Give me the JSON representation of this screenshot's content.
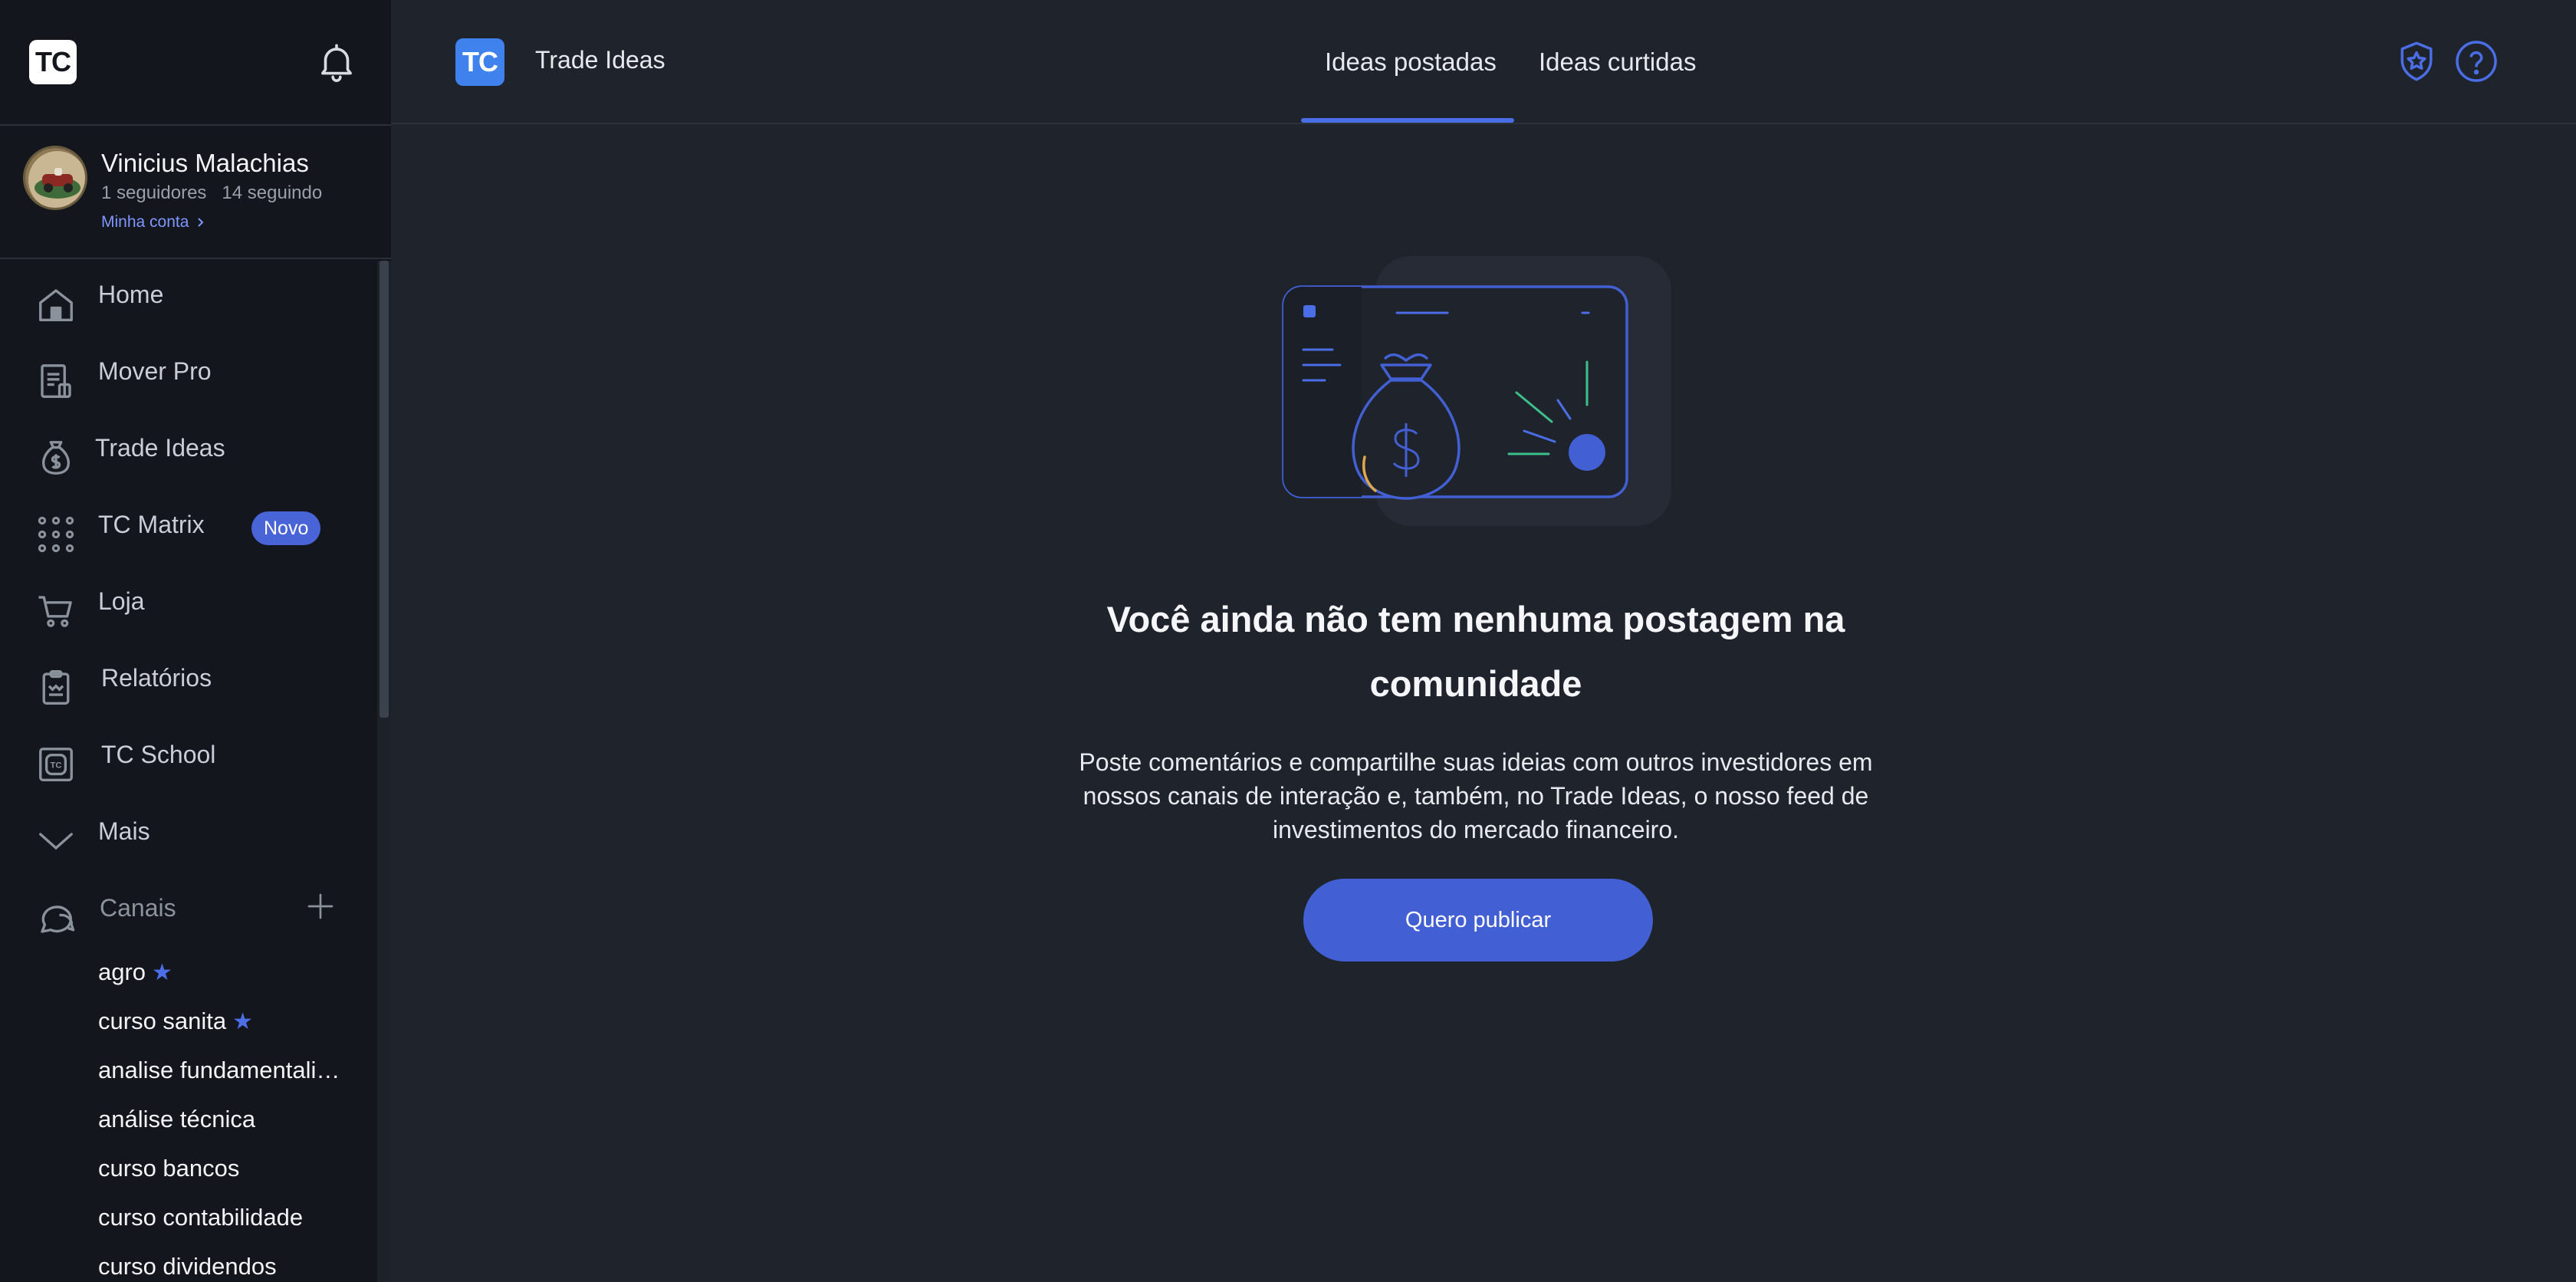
{
  "sidebar": {
    "logo_text": "TC",
    "profile": {
      "name": "Vinicius Malachias",
      "stats": "1 seguidores   14 seguindo",
      "account_link": "Minha conta"
    },
    "nav": [
      {
        "label": "Home",
        "icon": "home-icon"
      },
      {
        "label": "Mover Pro",
        "icon": "document-icon"
      },
      {
        "label": "Trade Ideas",
        "icon": "money-bag-icon"
      },
      {
        "label": "TC Matrix",
        "icon": "grid-dots-icon",
        "badge": "Novo"
      },
      {
        "label": "Loja",
        "icon": "cart-icon"
      },
      {
        "label": "Relatórios",
        "icon": "report-icon"
      },
      {
        "label": "TC School",
        "icon": "school-icon"
      },
      {
        "label": "Mais",
        "icon": "chevron-down-icon"
      },
      {
        "label": "Canais",
        "icon": "chat-bubble-icon"
      }
    ],
    "channels": [
      {
        "label": "agro",
        "starred": true
      },
      {
        "label": "curso sanita",
        "starred": true
      },
      {
        "label": "analise fundamentalista",
        "starred": false
      },
      {
        "label": "análise técnica",
        "starred": false
      },
      {
        "label": "curso bancos",
        "starred": false
      },
      {
        "label": "curso contabilidade",
        "starred": false
      },
      {
        "label": "curso dividendos",
        "starred": false
      }
    ],
    "star_glyph": "★"
  },
  "header": {
    "logo_text": "TC",
    "title": "Trade Ideas",
    "tabs": [
      {
        "label": "Ideas postadas",
        "active": true
      },
      {
        "label": "Ideas curtidas",
        "active": false
      }
    ]
  },
  "main": {
    "empty_title": "Você ainda não tem nenhuma postagem na comunidade",
    "empty_description": "Poste comentários e compartilhe suas ideias com outros investidores em nossos canais de interação e, também, no Trade Ideas, o nosso feed de investimentos do mercado financeiro.",
    "cta_label": "Quero publicar"
  },
  "colors": {
    "accent": "#4260d3",
    "sidebar_bg": "#13161c",
    "main_bg": "#1f232b"
  }
}
